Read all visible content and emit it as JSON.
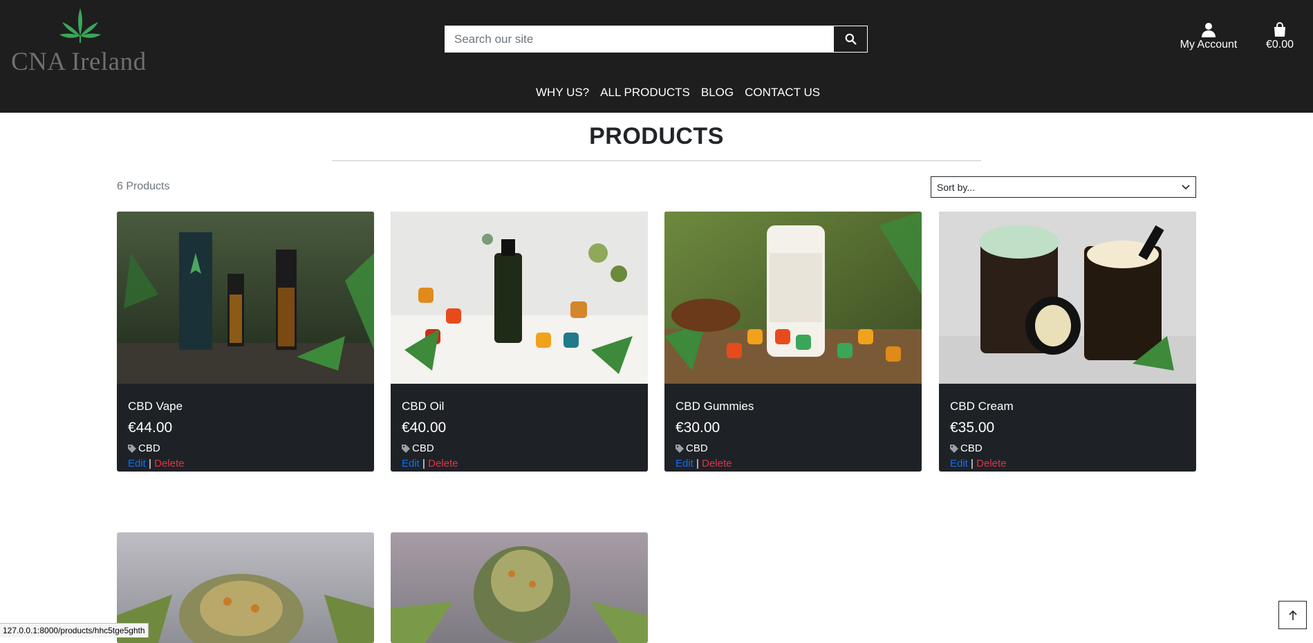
{
  "brand": {
    "name": "CNA Ireland"
  },
  "search": {
    "placeholder": "Search our site"
  },
  "account": {
    "label": "My Account"
  },
  "bag": {
    "total": "€0.00"
  },
  "nav": [
    "WHY US?",
    "ALL PRODUCTS",
    "BLOG",
    "CONTACT US"
  ],
  "page": {
    "title": "PRODUCTS",
    "count": "6 Products",
    "sort_value": "Sort by..."
  },
  "products": [
    {
      "name": "CBD Vape",
      "price": "€44.00",
      "category": "CBD",
      "edit": "Edit",
      "sep": "|",
      "delete": "Delete"
    },
    {
      "name": "CBD Oil",
      "price": "€40.00",
      "category": "CBD",
      "edit": "Edit",
      "sep": "|",
      "delete": "Delete"
    },
    {
      "name": "CBD Gummies",
      "price": "€30.00",
      "category": "CBD",
      "edit": "Edit",
      "sep": "|",
      "delete": "Delete"
    },
    {
      "name": "CBD Cream",
      "price": "€35.00",
      "category": "CBD",
      "edit": "Edit",
      "sep": "|",
      "delete": "Delete"
    }
  ],
  "status_url": "127.0.0.1:8000/products/hhc5tge5ghth",
  "colors": {
    "header_bg": "#1e1e1e",
    "card_bg": "#1e2227",
    "edit_link": "#0d6efd",
    "delete_link": "#dc3545",
    "logo_green": "#3aa65a"
  }
}
